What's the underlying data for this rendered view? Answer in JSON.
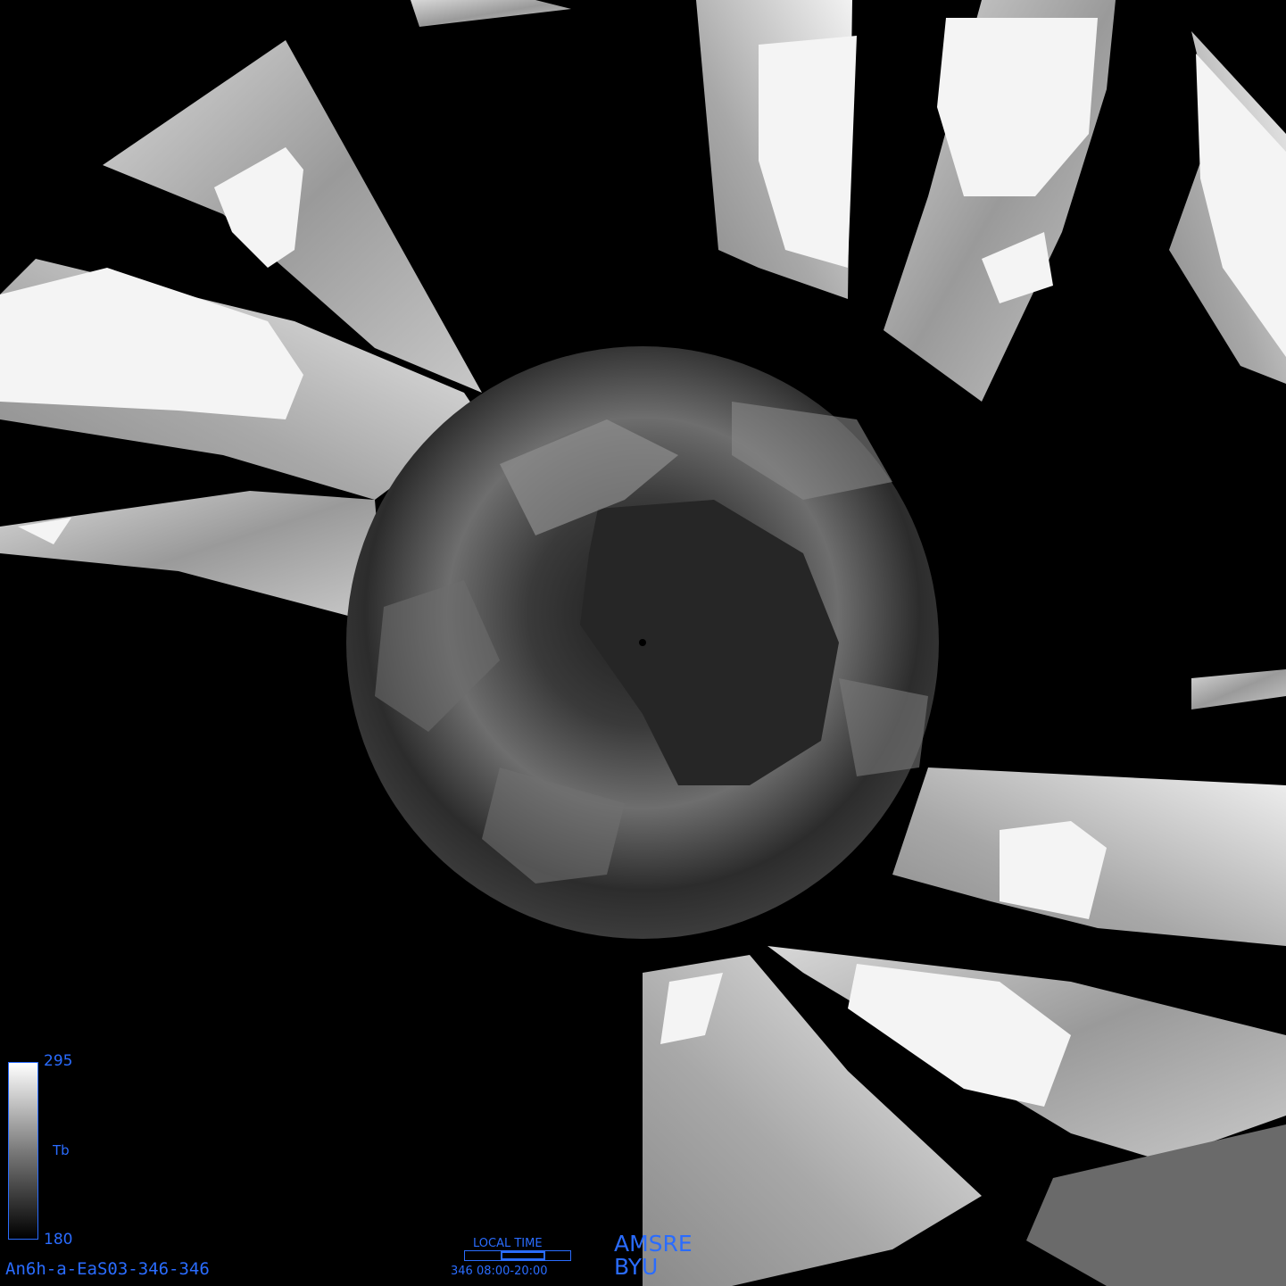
{
  "colorbar": {
    "max_label": "295",
    "min_label": "180",
    "variable_label": "Tb",
    "color_top": "#ffffff",
    "color_bottom": "#000000"
  },
  "product_id": "An6h-a-EaS03-346-346",
  "local_time": {
    "title": "LOCAL TIME",
    "range": "346 08:00-20:00"
  },
  "sensor": "AMSRE",
  "organization": "BYU",
  "colors": {
    "background": "#000000",
    "annotation": "#2a6cff"
  }
}
